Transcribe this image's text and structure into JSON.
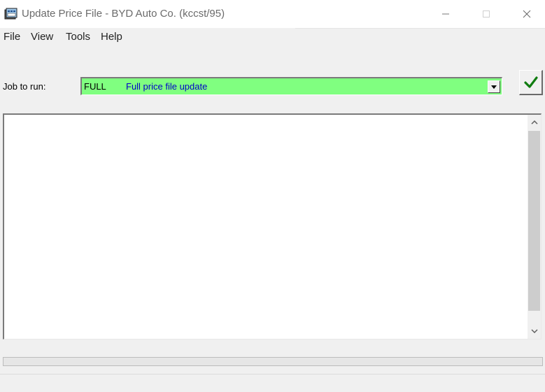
{
  "window": {
    "title": "Update Price File - BYD Auto Co. (kccst/95)",
    "controls": {
      "minimize": "minimize-icon",
      "maximize": "maximize-icon",
      "close": "close-icon"
    }
  },
  "menu": {
    "file": "File",
    "view": "View",
    "tools": "Tools",
    "help": "Help"
  },
  "job": {
    "label": "Job to run:",
    "selected_code": "FULL",
    "selected_description": "Full price file update",
    "field_color": "#80ff80",
    "description_color": "#0000c8"
  },
  "run_button": {
    "icon": "checkmark-icon",
    "color": "#107c10"
  },
  "log": {
    "text": ""
  },
  "progress": {
    "fraction": 0
  }
}
